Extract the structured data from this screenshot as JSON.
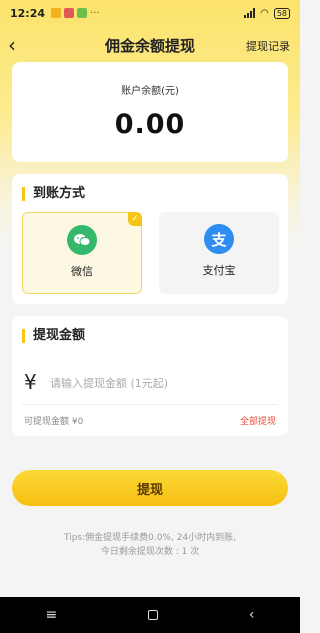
{
  "status_bar": {
    "time": "12:24",
    "battery": "58"
  },
  "header": {
    "title": "佣金余额提现",
    "records_link": "提现记录",
    "back_icon": "chevron-left-icon"
  },
  "balance": {
    "label": "账户余额(元)",
    "value": "0.00"
  },
  "payment": {
    "title": "到账方式",
    "options": [
      {
        "label": "微信",
        "icon": "wechat-icon",
        "color": "#35b86b",
        "selected": true
      },
      {
        "label": "支付宝",
        "icon": "alipay-icon",
        "color": "#2f8cf0",
        "selected": false
      }
    ]
  },
  "amount": {
    "title": "提现金额",
    "currency": "¥",
    "placeholder": "请输入提现金额 (1元起)",
    "available": "可提现金额 ¥0",
    "withdraw_all": "全部提现"
  },
  "submit_label": "提现",
  "tips": {
    "line1": "Tips:佣金提现手续费0.0%, 24小时内到账,",
    "line2": "今日剩余提现次数 : 1 次"
  },
  "accent_color": "#f7c614"
}
